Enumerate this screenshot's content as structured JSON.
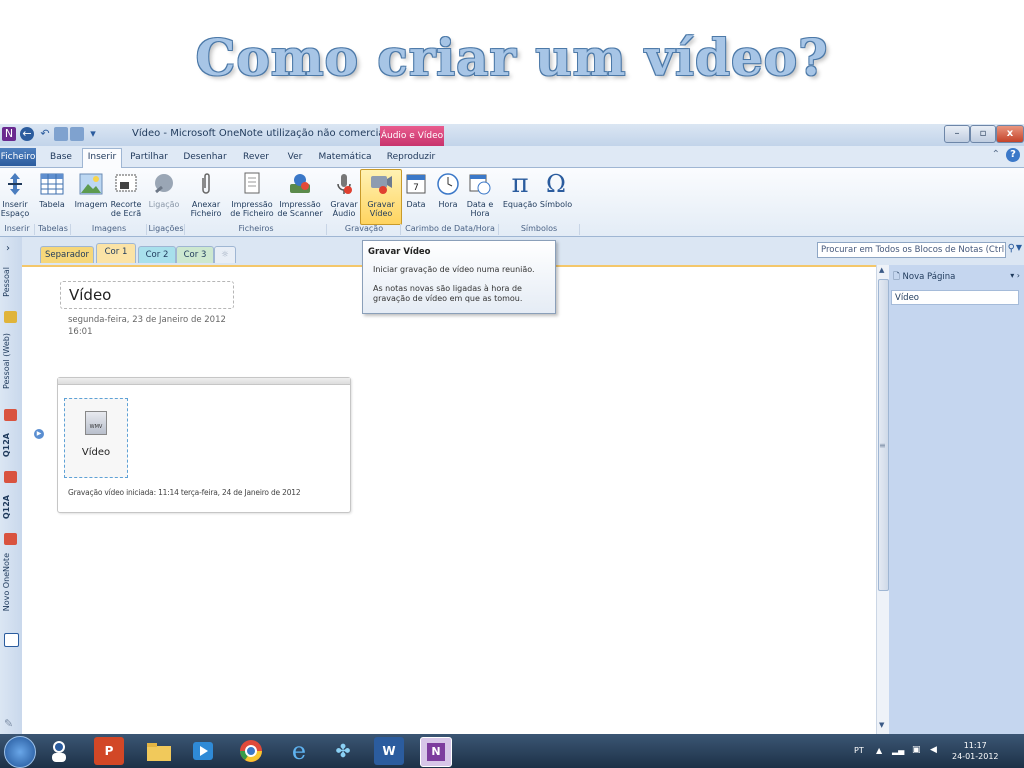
{
  "slide_title": "Como criar um vídeo?",
  "window": {
    "title": "Vídeo - Microsoft OneNote utilização não comercial",
    "context_tab": "Áudio e Vídeo",
    "minimize": "–",
    "maximize": "▫",
    "close": "x"
  },
  "tabs": [
    "Ficheiro",
    "Base",
    "Inserir",
    "Partilhar",
    "Desenhar",
    "Rever",
    "Ver",
    "Matemática",
    "Reproduzir"
  ],
  "ribbon": {
    "buttons": {
      "inserir_espaco": "Inserir Espaço",
      "tabela": "Tabela",
      "imagem": "Imagem",
      "recorte": "Recorte de Ecrã",
      "ligacao": "Ligação",
      "anexar": "Anexar Ficheiro",
      "impressao_ficheiro": "Impressão de Ficheiro",
      "impressao_scanner": "Impressão de Scanner",
      "gravar_audio": "Gravar Áudio",
      "gravar_video": "Gravar Vídeo",
      "data": "Data",
      "hora": "Hora",
      "data_hora": "Data e Hora",
      "equacao": "Equação",
      "simbolo": "Símbolo"
    },
    "groups": {
      "inserir": "Inserir",
      "tabelas": "Tabelas",
      "imagens": "Imagens",
      "ligacoes": "Ligações",
      "ficheiros": "Ficheiros",
      "gravacao": "Gravação",
      "carimbo": "Carimbo de Data/Hora",
      "simbolos": "Símbolos"
    }
  },
  "tooltip": {
    "title": "Gravar Vídeo",
    "line1": "Iniciar gravação de vídeo numa reunião.",
    "line2": "As notas novas são ligadas à hora de gravação de vídeo em que as tomou."
  },
  "notebooks": [
    "Pessoal",
    "Pessoal (Web)",
    "Q12A",
    "Q12A",
    "Novo OneNote"
  ],
  "sections": [
    "Separador",
    "Cor 1",
    "Cor 2",
    "Cor 3"
  ],
  "search_placeholder": "Procurar em Todos os Blocos de Notas (Ctrl+E)",
  "page": {
    "title": "Vídeo",
    "date": "segunda-feira, 23 de Janeiro de 2012",
    "time": "16:01",
    "video_label": "Vídeo",
    "file_type": "WMV",
    "recording_caption": "Gravação vídeo iniciada: 11:14 terça-feira, 24 de Janeiro de 2012"
  },
  "pages_pane": {
    "new_page": "Nova Página",
    "items": [
      "Vídeo"
    ]
  },
  "taskbar": {
    "language": "PT",
    "time": "11:17",
    "date": "24-01-2012"
  },
  "colors": {
    "accent": "#2b5c9e",
    "context_tab": "#c8336c",
    "section_separador": "#f6d77a",
    "section_cor1": "#fbe3a6",
    "section_cor2": "#a8e0ec",
    "section_cor3": "#cde8d0"
  }
}
